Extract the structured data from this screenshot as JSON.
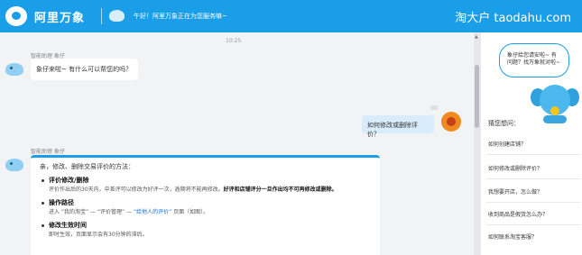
{
  "header": {
    "logo_text": "阿里万象",
    "greeting": "午好！阿里万象正在为您服务嘛~",
    "brand_mark": "淘大户 taodahu.com"
  },
  "chat": {
    "timestamp": "10:25",
    "bot_name": "智能助理 象仔",
    "messages": [
      {
        "text": "象仔来啦~ 有什么可以帮您的吗？"
      }
    ],
    "user_message": "如何修改或删除评价？",
    "answer": {
      "intro": "亲，修改、删除交易评价的方法：",
      "sections": [
        {
          "title": "评价修改/删除",
          "body_plain": "评价作出后的30天内，中差评可以修改为好评一次，逾期将不能再修改。",
          "body_bold": "好评和店铺评分一旦作出均不可再修改或删除。"
        },
        {
          "title": "操作路径",
          "path_prefix": "进入 “我的淘宝” — “评价管理” — ",
          "path_link": "“给他人的评价”",
          "path_suffix": " 页面（如图）。"
        },
        {
          "title": "修改生效时间",
          "body_plain": "即时生效，页面显示会有30分钟的滞后。"
        }
      ]
    }
  },
  "sidebar": {
    "cloud_text": "象仔给您请安啦~ 有问题？找万象就对啦~",
    "heading": "猜您想问：",
    "faq": [
      "如何创建店铺？",
      "如何修改或删除评价？",
      "我想要开店，怎么做？",
      "收到商品是假货怎么办？",
      "如何联系淘宝客服？"
    ]
  },
  "colors": {
    "brand_blue": "#1a9ee8",
    "link_blue": "#1a6fd4",
    "user_bubble": "#d8ecfb"
  }
}
